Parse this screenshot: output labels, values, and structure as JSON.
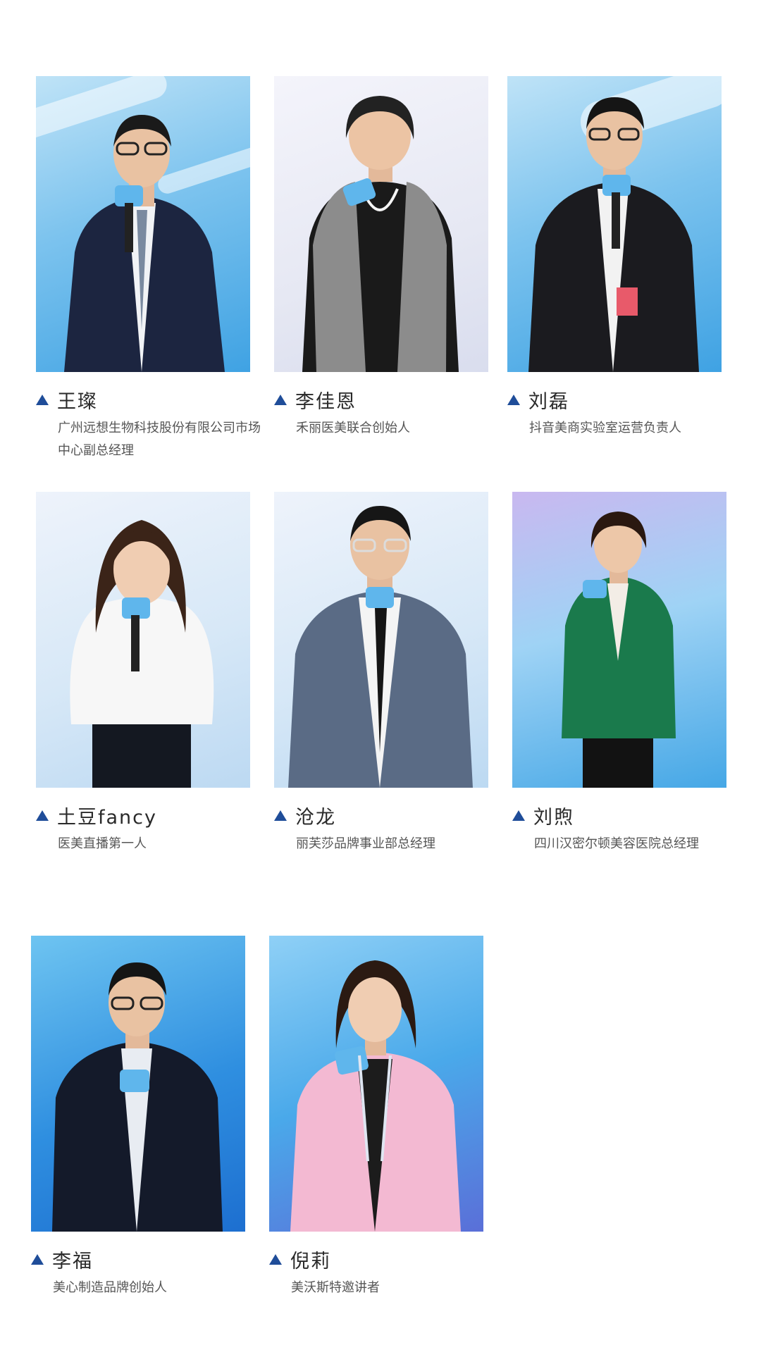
{
  "speakers": [
    {
      "name": "王璨",
      "title": "广州远想生物科技股份有限公司市场中心副总经理"
    },
    {
      "name": "李佳恩",
      "title": "禾丽医美联合创始人"
    },
    {
      "name": "刘磊",
      "title": "抖音美商实验室运营负责人"
    },
    {
      "name": "土豆fancy",
      "title": "医美直播第一人"
    },
    {
      "name": "沧龙",
      "title": "丽芙莎品牌事业部总经理"
    },
    {
      "name": "刘煦",
      "title": "四川汉密尔顿美容医院总经理"
    },
    {
      "name": "李福",
      "title": "美心制造品牌创始人"
    },
    {
      "name": "倪莉",
      "title": "美沃斯特邀讲者"
    }
  ]
}
